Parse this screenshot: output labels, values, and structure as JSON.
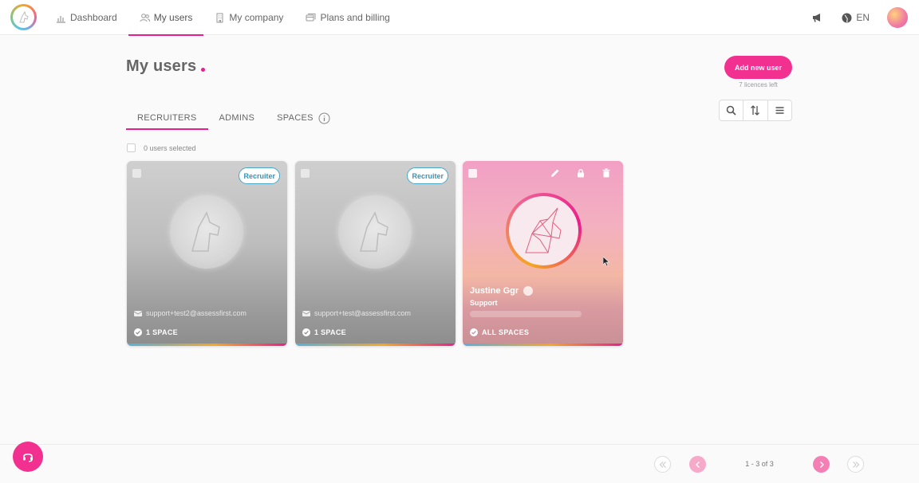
{
  "nav": {
    "items": [
      {
        "label": "Dashboard",
        "icon": "chart-icon"
      },
      {
        "label": "My users",
        "icon": "users-icon"
      },
      {
        "label": "My company",
        "icon": "building-icon"
      },
      {
        "label": "Plans and billing",
        "icon": "billing-icon"
      }
    ],
    "active_index": 1,
    "language": "EN"
  },
  "page": {
    "title": "My users",
    "add_button": "Add new user",
    "licences_left": "7 licences left"
  },
  "tabs": [
    {
      "label": "RECRUITERS"
    },
    {
      "label": "ADMINS"
    },
    {
      "label": "SPACES"
    }
  ],
  "selection": {
    "label": "0 users selected"
  },
  "cards": [
    {
      "badge": "Recruiter",
      "email": "support+test2@assessfirst.com",
      "spaces": "1 SPACE"
    },
    {
      "badge": "Recruiter",
      "email": "support+test@assessfirst.com",
      "spaces": "1 SPACE"
    },
    {
      "name": "Justine Ggr",
      "role": "Support",
      "spaces": "ALL SPACES"
    }
  ],
  "pagination": {
    "info": "1 - 3 of 3"
  },
  "colors": {
    "accent": "#e91e8c",
    "button": "#f2308f",
    "badge": "#3a93b3"
  }
}
